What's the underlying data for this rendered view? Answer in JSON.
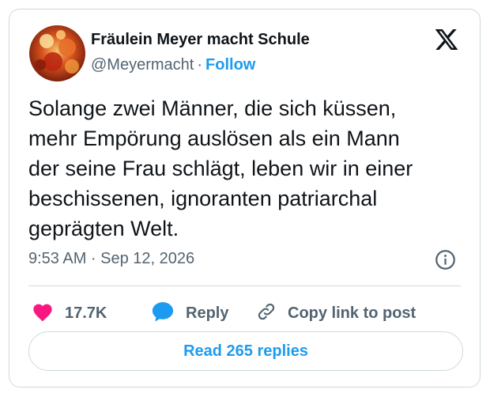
{
  "author": {
    "display_name": "Fräulein Meyer macht Schule",
    "handle": "@Meyermacht",
    "separator": "·",
    "follow_label": "Follow",
    "avatar_icon": "autumn-leaves-avatar"
  },
  "post": {
    "text": "Solange zwei Männer, die sich küssen,\nmehr Empörung auslösen als ein Mann\nder seine Frau schlägt, leben wir in einer\nbeschissenen, ignoranten patriarchal\ngeprägten Welt.",
    "timestamp": "9:53 AM · Sep 12, 2026"
  },
  "actions": {
    "like_count": "17.7K",
    "reply_label": "Reply",
    "copy_label": "Copy link to post"
  },
  "footer": {
    "read_replies_label": "Read 265 replies"
  },
  "colors": {
    "accent": "#1d9bf0",
    "like": "#f91880",
    "text_secondary": "#536471",
    "border": "#cfd9de"
  },
  "icons": [
    "x-logo-icon",
    "info-icon",
    "heart-icon",
    "reply-bubble-icon",
    "link-icon"
  ]
}
